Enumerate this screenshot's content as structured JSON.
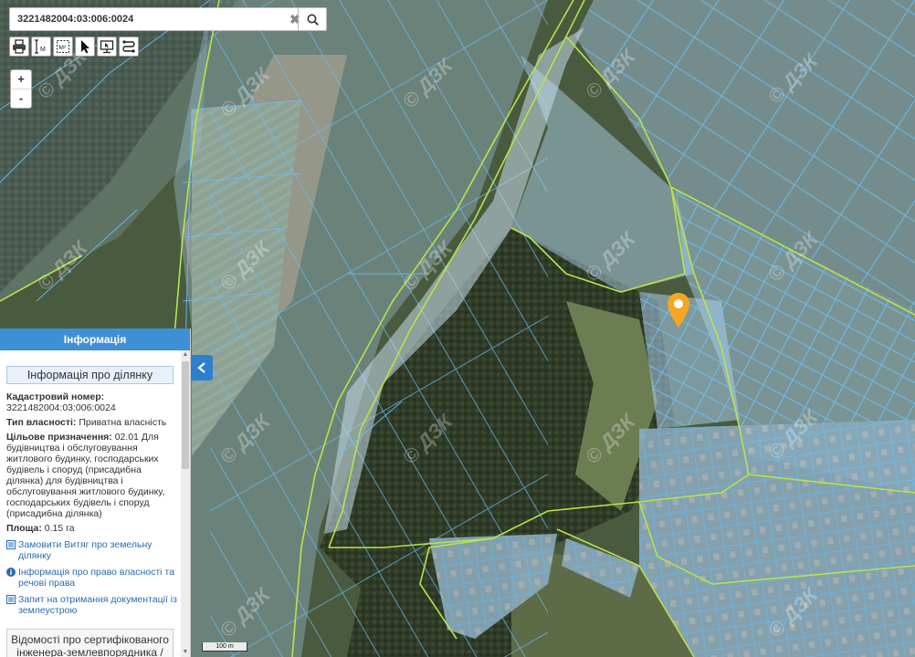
{
  "search": {
    "value": "3221482004:03:006:0024"
  },
  "icons": {
    "clear": "close-icon",
    "search": "search-icon",
    "tools": [
      "printer-icon",
      "measure-length-icon",
      "measure-area-icon",
      "pointer-icon",
      "screen-icon",
      "route-icon"
    ],
    "marker": "location-pin-icon"
  },
  "tools": {
    "measure_length_glyph": "M",
    "measure_area_glyph": "M²"
  },
  "zoom": {
    "in": "+",
    "out": "-"
  },
  "panel": {
    "header": "Інформація",
    "section_title": "Інформація про ділянку",
    "cadastral_label": "Кадастровий номер:",
    "cadastral_value": "3221482004:03:006:0024",
    "ownership_label": "Тип власності:",
    "ownership_value": " Приватна власність",
    "purpose_label": "Цільове призначення:",
    "purpose_value": " 02.01 Для будівництва і обслуговування житлового будинку, господарських будівель і споруд (присадибна ділянка) для будівництва і обслуговування житлового будинку, господарських будівель і споруд (присадибна ділянка)",
    "area_label": "Площа:",
    "area_value": " 0.15 га",
    "links": [
      {
        "icon": "document-icon",
        "label": "Замовити Витяг про земельну ділянку"
      },
      {
        "icon": "info-icon",
        "label": "Інформація про право власності та речові права"
      },
      {
        "icon": "document-icon",
        "label": "Запит на отримання документації із землеустрою"
      }
    ],
    "engineer_box": "Відомості про сертифікованого інженера-землевпорядника / БЕЗПОСЕРЕДНІЙ ВИКОНАВЕЦЬ"
  },
  "scale_label": "100 m",
  "watermark": "© ДЗК",
  "colors": {
    "accent": "#3f8fd6",
    "parcel_fill": "#a9cdea",
    "parcel_stroke": "#5eb4f0",
    "boundary": "#b8e34a",
    "marker": "#f5a623"
  }
}
